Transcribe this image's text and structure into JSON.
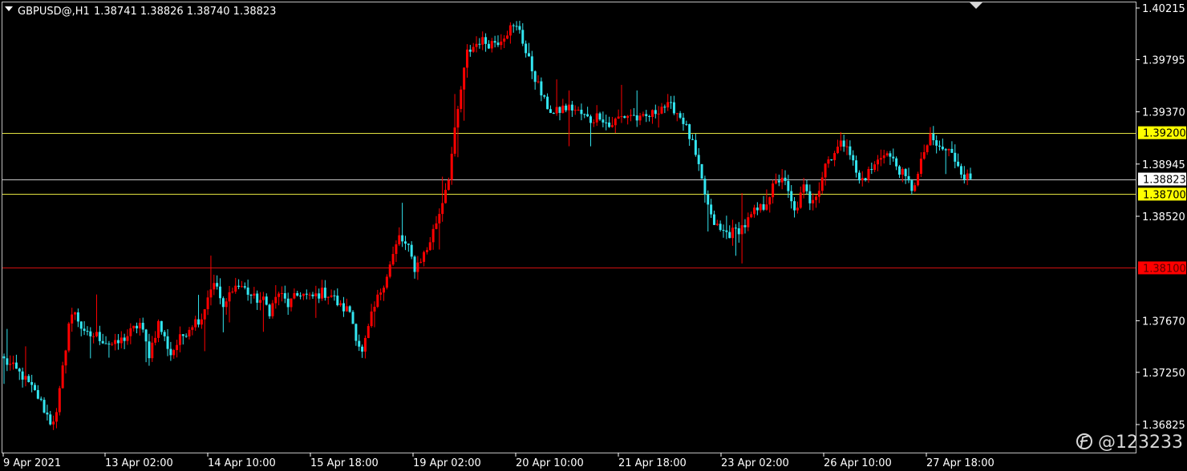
{
  "header": {
    "symbol": "GBPUSD@,H1",
    "ohlc": "1.38741 1.38826 1.38740 1.38823"
  },
  "watermark": {
    "text": "@123233",
    "icon": "brand-logo-icon"
  },
  "colors": {
    "background": "#000000",
    "bull": "#ff0000",
    "bear": "#33e5f0",
    "support_line": "#e0e040",
    "resistance_line": "#d01010",
    "current_line": "#c8c8c8",
    "axis": "#ffffff"
  },
  "chart_data": {
    "type": "candlestick",
    "title": "GBPUSD@,H1",
    "y_ticks": [
      "1.40215",
      "1.39795",
      "1.39370",
      "1.38945",
      "1.38520",
      "1.37670",
      "1.37250",
      "1.36825"
    ],
    "x_ticks": [
      "9 Apr 2021",
      "13 Apr 02:00",
      "14 Apr 10:00",
      "15 Apr 18:00",
      "19 Apr 02:00",
      "20 Apr 10:00",
      "21 Apr 18:00",
      "23 Apr 02:00",
      "26 Apr 10:00",
      "27 Apr 18:00"
    ],
    "ylim": [
      1.3677,
      1.4025
    ],
    "horizontal_lines": [
      {
        "price": 1.392,
        "label": "1.39200",
        "style": "yellow"
      },
      {
        "price": 1.38823,
        "label": "1.38823",
        "style": "current"
      },
      {
        "price": 1.387,
        "label": "1.38700",
        "style": "yellow"
      },
      {
        "price": 1.381,
        "label": "1.38100",
        "style": "red"
      }
    ],
    "close_path": [
      [
        0,
        1.3735
      ],
      [
        6,
        1.3722
      ],
      [
        11,
        1.3705
      ],
      [
        15,
        1.3685
      ],
      [
        17,
        1.369
      ],
      [
        21,
        1.3765
      ],
      [
        23,
        1.3775
      ],
      [
        26,
        1.3755
      ],
      [
        30,
        1.3755
      ],
      [
        33,
        1.375
      ],
      [
        36,
        1.3747
      ],
      [
        40,
        1.3755
      ],
      [
        44,
        1.3765
      ],
      [
        47,
        1.374
      ],
      [
        50,
        1.3765
      ],
      [
        54,
        1.374
      ],
      [
        57,
        1.3752
      ],
      [
        61,
        1.3765
      ],
      [
        64,
        1.377
      ],
      [
        67,
        1.3795
      ],
      [
        69,
        1.3795
      ],
      [
        71,
        1.3775
      ],
      [
        74,
        1.3795
      ],
      [
        77,
        1.3795
      ],
      [
        81,
        1.3785
      ],
      [
        84,
        1.3783
      ],
      [
        86,
        1.3775
      ],
      [
        89,
        1.379
      ],
      [
        92,
        1.378
      ],
      [
        96,
        1.379
      ],
      [
        99,
        1.3785
      ],
      [
        103,
        1.379
      ],
      [
        106,
        1.3788
      ],
      [
        109,
        1.3778
      ],
      [
        112,
        1.3775
      ],
      [
        114,
        1.3755
      ],
      [
        116,
        1.374
      ],
      [
        119,
        1.377
      ],
      [
        121,
        1.3785
      ],
      [
        124,
        1.3805
      ],
      [
        128,
        1.3835
      ],
      [
        131,
        1.3825
      ],
      [
        133,
        1.381
      ],
      [
        137,
        1.3825
      ],
      [
        141,
        1.3855
      ],
      [
        144,
        1.3885
      ],
      [
        146,
        1.392
      ],
      [
        148,
        1.3955
      ],
      [
        150,
        1.3985
      ],
      [
        154,
        1.3995
      ],
      [
        157,
        1.3993
      ],
      [
        160,
        1.3995
      ],
      [
        164,
        1.4005
      ],
      [
        167,
        1.4005
      ],
      [
        169,
        1.3985
      ],
      [
        172,
        1.3965
      ],
      [
        175,
        1.3945
      ],
      [
        178,
        1.3935
      ],
      [
        181,
        1.394
      ],
      [
        184,
        1.394
      ],
      [
        187,
        1.3935
      ],
      [
        190,
        1.393
      ],
      [
        193,
        1.3935
      ],
      [
        196,
        1.3925
      ],
      [
        199,
        1.3932
      ],
      [
        203,
        1.3935
      ],
      [
        206,
        1.393
      ],
      [
        210,
        1.3935
      ],
      [
        213,
        1.3942
      ],
      [
        217,
        1.394
      ],
      [
        220,
        1.393
      ],
      [
        223,
        1.391
      ],
      [
        225,
        1.389
      ],
      [
        227,
        1.387
      ],
      [
        229,
        1.385
      ],
      [
        232,
        1.384
      ],
      [
        235,
        1.3838
      ],
      [
        237,
        1.384
      ],
      [
        240,
        1.3845
      ],
      [
        243,
        1.3855
      ],
      [
        246,
        1.386
      ],
      [
        249,
        1.3875
      ],
      [
        252,
        1.3885
      ],
      [
        254,
        1.387
      ],
      [
        256,
        1.3855
      ],
      [
        259,
        1.3875
      ],
      [
        261,
        1.3865
      ],
      [
        264,
        1.3875
      ],
      [
        266,
        1.3895
      ],
      [
        269,
        1.3905
      ],
      [
        271,
        1.391
      ],
      [
        273,
        1.3913
      ],
      [
        275,
        1.3895
      ],
      [
        277,
        1.388
      ],
      [
        279,
        1.3885
      ],
      [
        282,
        1.3893
      ],
      [
        285,
        1.3905
      ],
      [
        287,
        1.39
      ],
      [
        290,
        1.389
      ],
      [
        292,
        1.3882
      ],
      [
        294,
        1.3875
      ],
      [
        296,
        1.3885
      ],
      [
        298,
        1.3905
      ],
      [
        300,
        1.3915
      ],
      [
        303,
        1.3907
      ],
      [
        306,
        1.3905
      ],
      [
        309,
        1.3895
      ],
      [
        311,
        1.3885
      ],
      [
        313,
        1.38823
      ]
    ]
  }
}
